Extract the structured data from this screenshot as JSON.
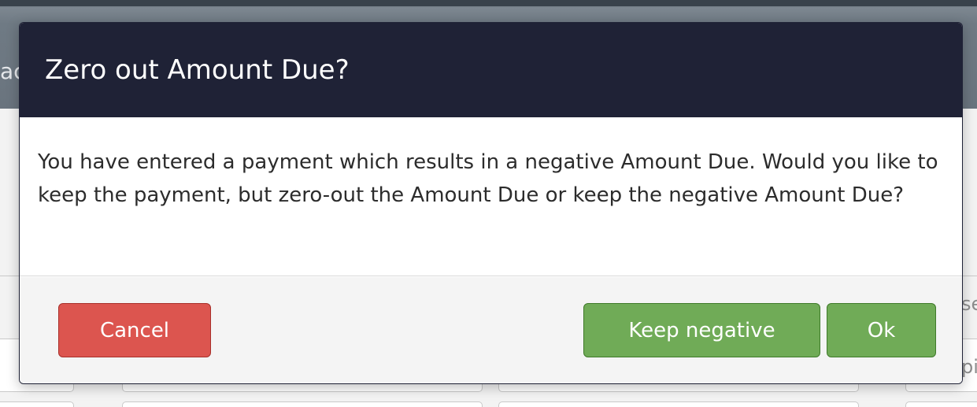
{
  "background": {
    "header_text": "ac",
    "right_text_1": "se",
    "right_text_2": "pi"
  },
  "modal": {
    "title": "Zero out Amount Due?",
    "message": "You have entered a payment which results in a negative Amount Due. Would you like to keep the payment, but zero-out the Amount Due or keep the negative Amount Due?",
    "buttons": {
      "cancel": "Cancel",
      "keep_negative": "Keep negative",
      "ok": "Ok"
    }
  },
  "colors": {
    "header_bg": "#1f2236",
    "cancel": "#dc554f",
    "primary": "#70ab57"
  }
}
